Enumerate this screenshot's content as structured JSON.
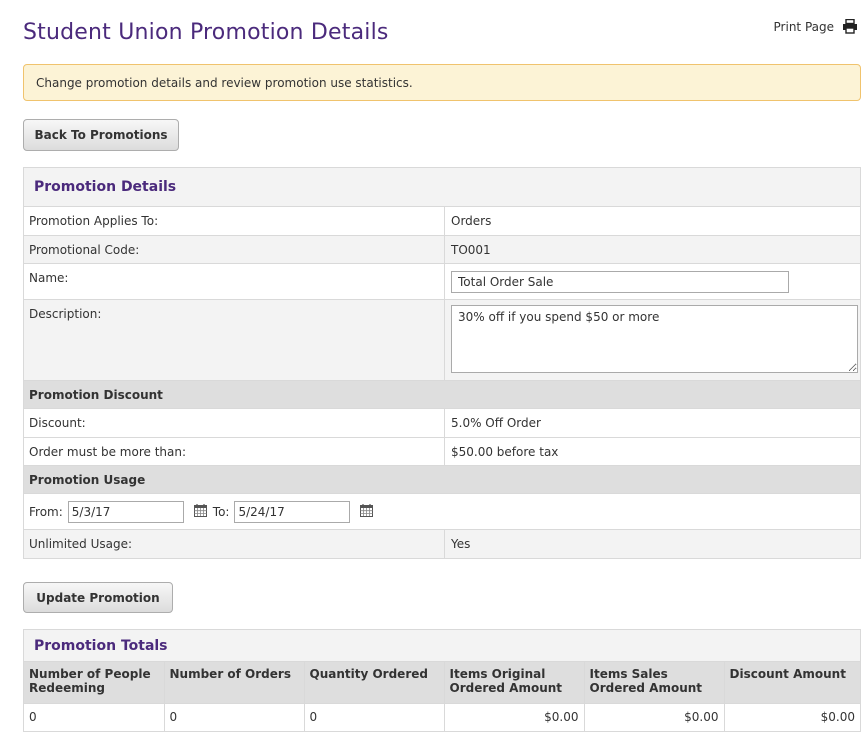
{
  "page": {
    "title": "Student Union Promotion Details",
    "print_label": "Print Page",
    "alert_text": "Change promotion details and review promotion use statistics."
  },
  "buttons": {
    "back": "Back To Promotions",
    "update": "Update Promotion"
  },
  "details": {
    "heading": "Promotion Details",
    "applies_to_label": "Promotion Applies To:",
    "applies_to_value": "Orders",
    "code_label": "Promotional Code:",
    "code_value": "TO001",
    "name_label": "Name:",
    "name_value": "Total Order Sale",
    "description_label": "Description:",
    "description_value": "30% off if you spend $50 or more"
  },
  "discount": {
    "heading": "Promotion Discount",
    "discount_label": "Discount:",
    "discount_value": "5.0% Off Order",
    "minimum_label": "Order must be more than:",
    "minimum_value": "$50.00 before tax"
  },
  "usage": {
    "heading": "Promotion Usage",
    "from_label": "From:",
    "from_value": "5/3/17",
    "to_label": "To:",
    "to_value": "5/24/17",
    "unlimited_label": "Unlimited Usage:",
    "unlimited_value": "Yes"
  },
  "totals": {
    "heading": "Promotion Totals",
    "columns": [
      "Number of People Redeeming",
      "Number of Orders",
      "Quantity Ordered",
      "Items Original Ordered Amount",
      "Items Sales Ordered Amount",
      "Discount Amount"
    ],
    "row": [
      "0",
      "0",
      "0",
      "$0.00",
      "$0.00",
      "$0.00"
    ]
  },
  "icons": {
    "print": "printer-icon",
    "calendar": "calendar-icon"
  },
  "colors": {
    "title": "#4b2a7c",
    "alert_bg": "#fcf3d6",
    "alert_border": "#f0c36d",
    "section_bg": "#dedede",
    "row_alt_bg": "#f3f3f3"
  }
}
